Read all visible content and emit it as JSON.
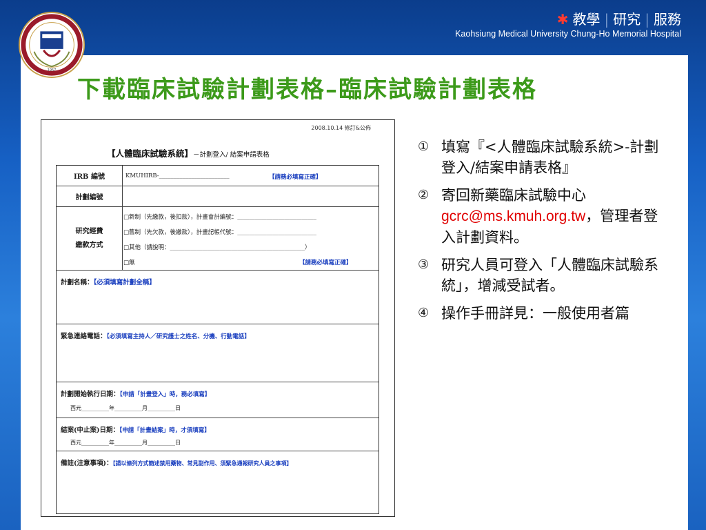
{
  "header": {
    "slogan": [
      "教學",
      "研究",
      "服務"
    ],
    "subtitle": "Kaohsiung Medical University  Chung-Ho Memorial Hospital",
    "accent_color": "#ff3b30"
  },
  "title": "下載臨床試驗計劃表格–臨床試驗計劃表格",
  "form": {
    "date": "2008.10.14 修訂&公佈",
    "title": "【人體臨床試驗系統】",
    "title_sub": "－計劃登入/ 結案申請表格",
    "rows": {
      "irb_label": "IRB 編號",
      "irb_value": "KMUHIRB-________________________",
      "irb_note": "【請務必填寫正確】",
      "plan_no_label": "計劃編號",
      "funding_label_1": "研究經費",
      "funding_label_2": "繳款方式",
      "funding_options": [
        "□新制（先繳款，後扣款），計畫會計編號：___________________________",
        "□舊制（先欠款，後繳款），計畫記帳代號：___________________________",
        "□其他（請說明：______________________________________________）",
        "□無"
      ],
      "funding_note": "【請務必填寫正確】",
      "plan_name_label": "計劃名稱：",
      "plan_name_note": "【必須填寫計劃全稱】",
      "emergency_label": "緊急連絡電話：",
      "emergency_note": "【必須填寫主持人／研究護士之姓名、分機、行動電話】",
      "start_label": "計劃開始執行日期：",
      "start_note": "【申請「計畫登入」時，務必填寫】",
      "start_date": "西元__________年__________月__________日",
      "end_label": "結案(中止案)日期：",
      "end_note": "【申請「計畫結案」時，才須填寫】",
      "end_date": "西元__________年__________月__________日",
      "remarks_label": "備註(注意事項)：",
      "remarks_note": "【請以條列方式簡述禁用藥物、常見副作用、須緊急通報研究人員之事項】"
    }
  },
  "steps": [
    {
      "num": "①",
      "text": "填寫『<人體臨床試驗系統>-計劃登入/結案申請表格』"
    },
    {
      "num": "②",
      "text_before": "寄回新藥臨床試驗中心",
      "email": "gcrc@ms.kmuh.org.tw",
      "text_after": "，管理者登入計劃資料。"
    },
    {
      "num": "③",
      "text": "研究人員可登入「人體臨床試驗系統」，增減受試者。"
    },
    {
      "num": "④",
      "text": "操作手冊詳見：一般使用者篇"
    }
  ]
}
